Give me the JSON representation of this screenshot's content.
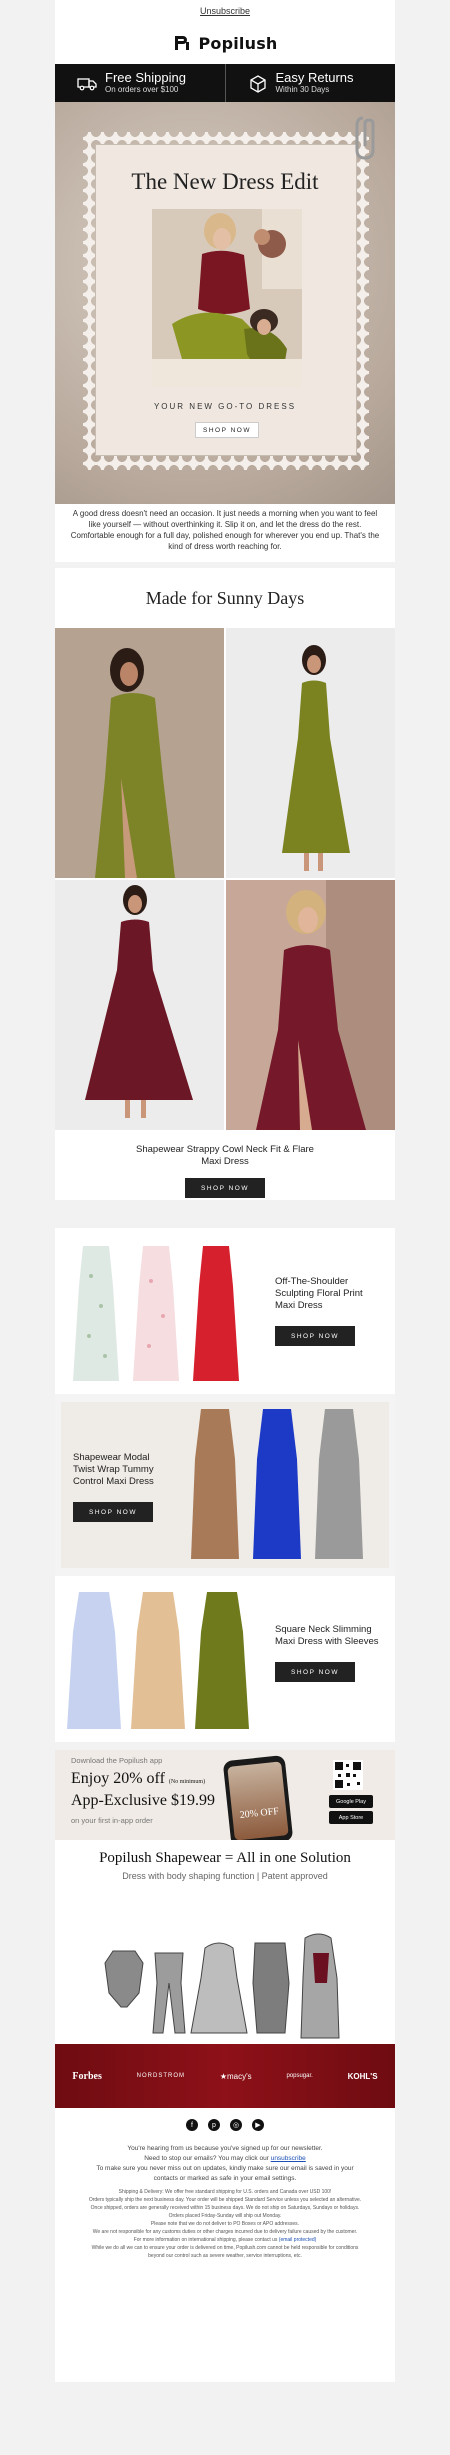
{
  "header": {
    "unsubscribe": "Unsubscribe",
    "brand": "Popilush"
  },
  "benefits": [
    {
      "title": "Free Shipping",
      "sub": "On orders over $100",
      "icon": "truck-icon"
    },
    {
      "title": "Easy Returns",
      "sub": "Within 30 Days",
      "icon": "return-box-icon"
    }
  ],
  "hero": {
    "title": "The New Dress Edit",
    "tagline": "YOUR NEW GO-TO DRESS",
    "button": "SHOP NOW"
  },
  "intro": "A good dress doesn't need an occasion. It just needs a morning when you want to feel like yourself — without overthinking it. Slip it on, and let the dress do the rest. Comfortable enough for a full day, polished enough for wherever you end up. That's the kind of dress worth reaching for.",
  "section1": {
    "title": "Made for Sunny Days",
    "product": "Shapewear Strappy Cowl Neck Fit & Flare Maxi Dress",
    "button": "SHOP NOW"
  },
  "products": [
    {
      "title": "Off-The-Shoulder Sculpting Floral Print Maxi Dress",
      "button": "SHOP NOW"
    },
    {
      "title": "Shapewear Modal Twist Wrap Tummy Control Maxi Dress",
      "button": "SHOP NOW"
    },
    {
      "title": "Square Neck Slimming Maxi Dress with Sleeves",
      "button": "SHOP NOW"
    }
  ],
  "app": {
    "download": "Download the Popilush app",
    "offer": "Enjoy 20% off",
    "offer_note": "(No minimum)",
    "exclusive": "App-Exclusive $19.99",
    "sub": "on your first in-app order",
    "google": "Google Play",
    "apple": "App Store",
    "phone_text": "20% OFF"
  },
  "shapewear": {
    "title": "Popilush Shapewear = All in one Solution",
    "sub": "Dress with body shaping function | Patent approved"
  },
  "retailers": [
    "Forbes",
    "NORDSTROM",
    "★macy's",
    "popsugar.",
    "KOHL'S"
  ],
  "footer": {
    "line1": "You're hearing from us because you've signed up for our newsletter.",
    "line2a": "Need to stop our emails? You may click our ",
    "line2link": "unsubscribe",
    "line3": "To make sure you never miss out on updates, kindly make sure our email is saved in your contacts or marked as safe in your email settings.",
    "small1": "Shipping & Delivery: We offer free standard shipping for U.S. orders and Canada over USD 100!",
    "small2": "Orders typically ship the next business day. Your order will be shipped Standard Service unless you selected an alternative.",
    "small3": "Once shipped, orders are generally received within 15 business days. We do not ship on Saturdays, Sundays or holidays.",
    "small4": "Orders placed Friday-Sunday will ship out Monday.",
    "small5": "Please note that we do not deliver to PO Boxes or APO addresses.",
    "small6": "We are not responsible for any customs duties or other charges incurred due to delivery failure caused by the customer.",
    "small7a": "For more information on international shipping, please contact us ",
    "small7link": "(email protected)",
    "small8": "While we do all we can to ensure your order is delivered on time, Popilush.com cannot be held responsible for conditions",
    "small9": "beyond our control such as severe weather, service interruptions, etc."
  },
  "colors": {
    "dark": "#111111",
    "retail_red": "#7f0f15",
    "olive": "#7a7f1e",
    "burgundy": "#6b1622"
  }
}
